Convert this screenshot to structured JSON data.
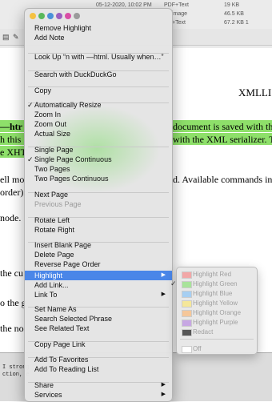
{
  "file_rows": [
    {
      "date": "05-12-2020, 10:02 PM",
      "kind": "PDF+Text",
      "size": "19 KB"
    },
    {
      "date": "",
      "kind": "image",
      "size": "46.5 KB"
    },
    {
      "date": "",
      "kind": "+Text",
      "size": "67.2 KB 1"
    }
  ],
  "doc_lines": {
    "heading": "XMLLI",
    "l1_left": "—htr",
    "l1_right": "document is saved with the",
    "l2_left": "h this",
    "l2_right": "with the XML serializer. T",
    "l3_left": "e XHT",
    "l4_left": "ell mo",
    "l4_right": "d. Available commands in s",
    "l5_left": "order):",
    "l6_left": "node.",
    "l7_left": "the cu",
    "l8_left": "o the g",
    "l9_left": "the no"
  },
  "console_lines": [
    "I strong",
    "ction, e"
  ],
  "tag_colors": [
    "#f5c142",
    "#58b85a",
    "#4a90d9",
    "#9b5fc0",
    "#d94ea6",
    "#9b9b9b"
  ],
  "menu": {
    "items": [
      {
        "label": "Remove Highlight"
      },
      {
        "label": "Add Note"
      },
      {
        "label": "Look Up “n with —html. Usually when…”"
      },
      {
        "label": "Search with DuckDuckGo"
      },
      {
        "label": "Copy"
      },
      {
        "label": "Automatically Resize",
        "checked": "✓"
      },
      {
        "label": "Zoom In"
      },
      {
        "label": "Zoom Out"
      },
      {
        "label": "Actual Size"
      },
      {
        "label": "Single Page"
      },
      {
        "label": "Single Page Continuous",
        "checked": "✓"
      },
      {
        "label": "Two Pages"
      },
      {
        "label": "Two Pages Continuous"
      },
      {
        "label": "Next Page"
      },
      {
        "label": "Previous Page"
      },
      {
        "label": "Rotate Left"
      },
      {
        "label": "Rotate Right"
      },
      {
        "label": "Insert Blank Page"
      },
      {
        "label": "Delete Page"
      },
      {
        "label": "Reverse Page Order"
      },
      {
        "label": "Highlight",
        "arrow": "▶"
      },
      {
        "label": "Add Link..."
      },
      {
        "label": "Link To",
        "arrow": "▶"
      },
      {
        "label": "Set Name As"
      },
      {
        "label": "Search Selected Phrase"
      },
      {
        "label": "See Related Text"
      },
      {
        "label": "Copy Page Link"
      },
      {
        "label": "Add To Favorites"
      },
      {
        "label": "Add To Reading List"
      },
      {
        "label": "Share",
        "arrow": "▶"
      },
      {
        "label": "Services",
        "arrow": "▶"
      }
    ]
  },
  "submenu": {
    "items": [
      {
        "label": "Highlight Red",
        "color": "#f2a7a7"
      },
      {
        "label": "Highlight Green",
        "color": "#a8e39a",
        "checked": "✓"
      },
      {
        "label": "Highlight Blue",
        "color": "#a7cff2"
      },
      {
        "label": "Highlight Yellow",
        "color": "#f5e79a"
      },
      {
        "label": "Highlight Orange",
        "color": "#f5c79a"
      },
      {
        "label": "Highlight Purple",
        "color": "#c7a7e3"
      },
      {
        "label": "Redact",
        "color": "#555555"
      },
      {
        "label": "Off",
        "color": "#ffffff"
      }
    ]
  }
}
